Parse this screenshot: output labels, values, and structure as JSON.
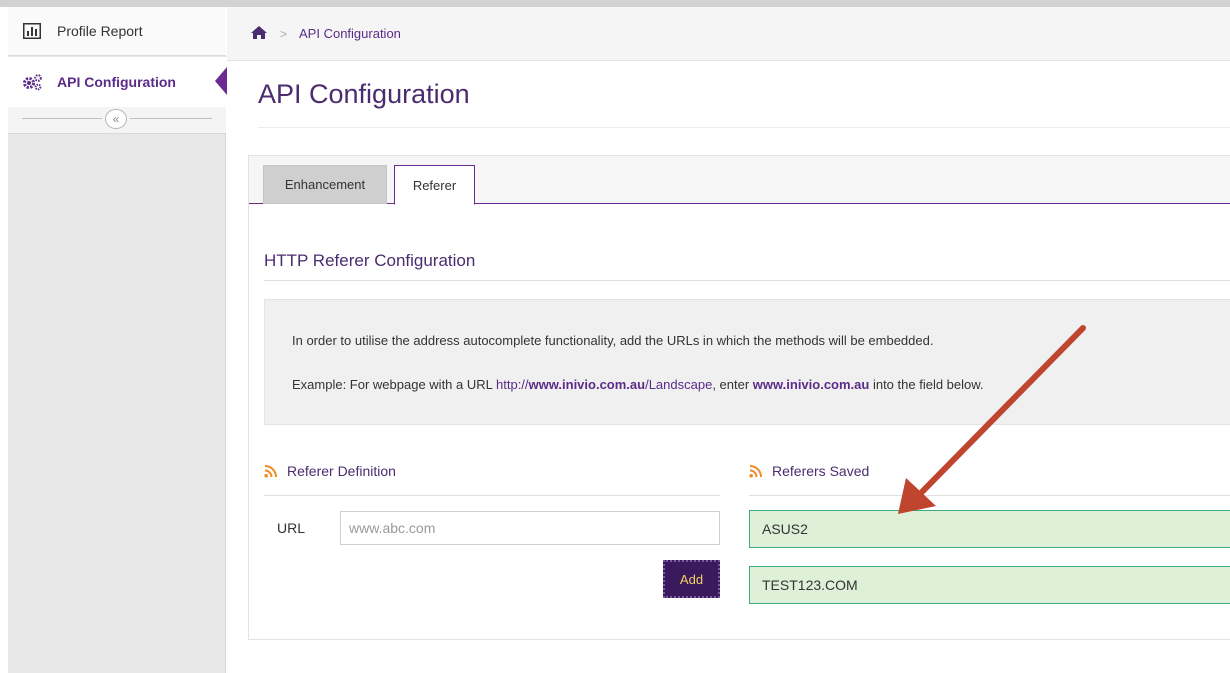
{
  "sidebar": {
    "items": [
      {
        "label": "Profile Report",
        "icon": "bar-chart-icon"
      },
      {
        "label": "API Configuration",
        "icon": "cogs-icon"
      }
    ],
    "collapse_glyph": "«"
  },
  "breadcrumb": {
    "home_icon": "home-icon",
    "separator": ">",
    "current": "API Configuration"
  },
  "page": {
    "title": "API Configuration"
  },
  "tabs": [
    {
      "label": "Enhancement",
      "active": false
    },
    {
      "label": "Referer",
      "active": true
    }
  ],
  "section": {
    "title": "HTTP Referer Configuration",
    "info_line1": "In order to utilise the address autocomplete functionality, add the URLs in which the methods will be embedded.",
    "info_line2": {
      "prefix": "Example: For webpage with a URL ",
      "url_scheme": "http://",
      "url_host": "www.inivio.com.au",
      "url_path": "/Landscape",
      "middle": ", enter ",
      "host_bold": "www.inivio.com.au",
      "suffix": " into the field below."
    }
  },
  "definition": {
    "heading": "Referer Definition",
    "url_label": "URL",
    "url_placeholder": "www.abc.com",
    "add_label": "Add"
  },
  "saved": {
    "heading": "Referers Saved",
    "items": [
      "ASUS2",
      "TEST123.COM"
    ]
  },
  "colors": {
    "brand_purple": "#5b2c88",
    "button_bg": "#3a1a5c",
    "button_text": "#f3d060",
    "saved_bg": "#dff0d8",
    "saved_border": "#3fae7e",
    "rss_orange": "#f08a24",
    "annotation_arrow": "#c0452f"
  }
}
